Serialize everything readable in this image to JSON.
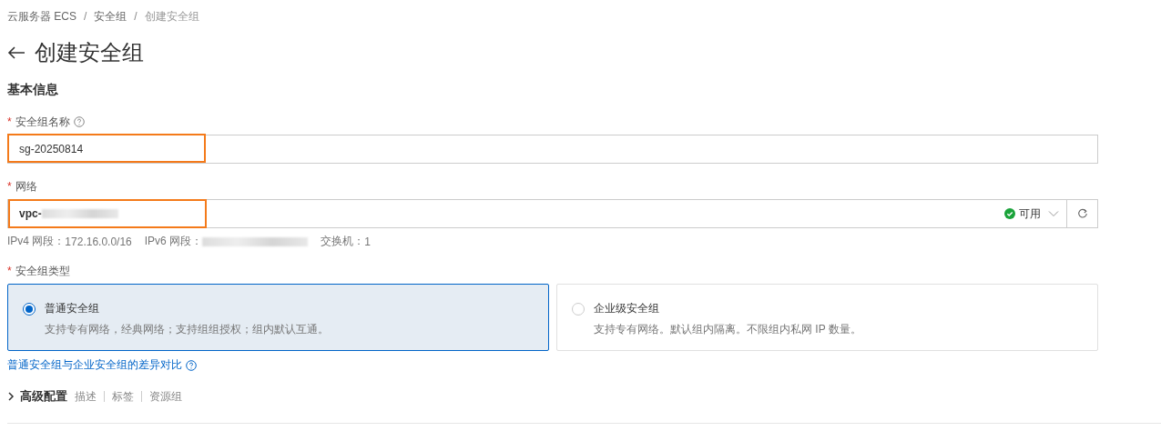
{
  "breadcrumb": [
    {
      "label": "云服务器 ECS",
      "current": false
    },
    {
      "label": "安全组",
      "current": false
    },
    {
      "label": "创建安全组",
      "current": true
    }
  ],
  "breadcrumb_separator": "/",
  "title": "创建安全组",
  "section_title": "基本信息",
  "name_field": {
    "label": "安全组名称",
    "required": true,
    "value": "sg-20250814",
    "highlighted": true
  },
  "network_field": {
    "label": "网络",
    "required": true,
    "value": "vpc-",
    "redacted": true,
    "highlighted": true,
    "status": "可用"
  },
  "required_mark": "*",
  "network_info": [
    {
      "label": "IPv4 网段：",
      "value": "172.16.0.0/16"
    },
    {
      "label": "IPv6 网段：",
      "redacted": true
    },
    {
      "label": "交换机：",
      "value": "1"
    }
  ],
  "type_field": {
    "label": "安全组类型",
    "required": true
  },
  "type_options": [
    {
      "title": "普通安全组",
      "description": "支持专有网络，经典网络；支持组组授权；组内默认互通。",
      "selected": true
    },
    {
      "title": "企业级安全组",
      "description": "支持专有网络。默认组内隔离。不限组内私网 IP 数量。",
      "selected": false
    }
  ],
  "compare_link": "普通安全组与企业安全组的差异对比",
  "advanced": {
    "title": "高级配置",
    "expanded": false,
    "items": [
      "描述",
      "标签",
      "资源组"
    ]
  }
}
